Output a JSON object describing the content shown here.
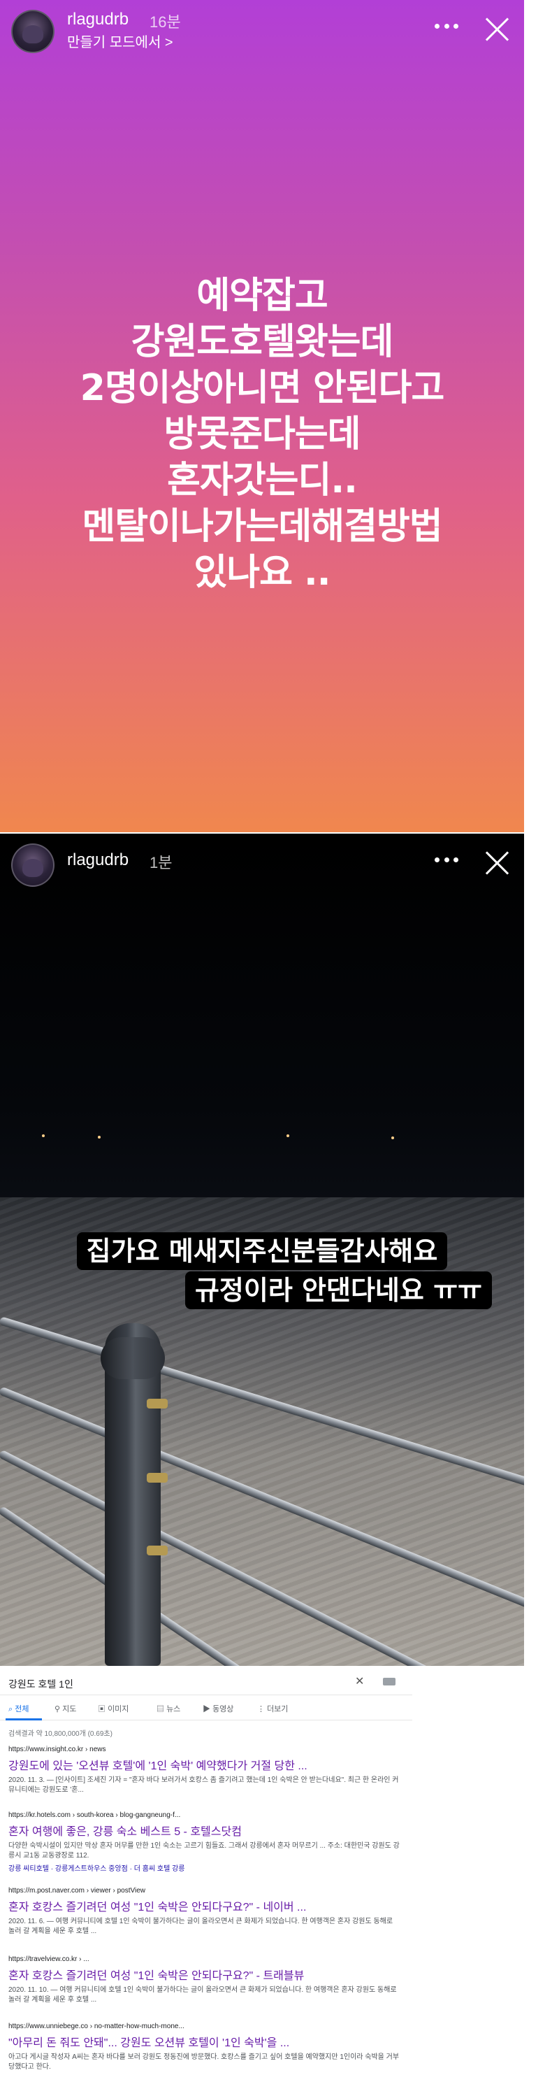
{
  "story1": {
    "username": "rlagudrb",
    "time": "16분",
    "subtitle": "만들기 모드에서 >",
    "lines": [
      "예약잡고",
      "강원도호텔왓는데",
      "2명이상아니면 안된다고",
      "방못준다는데",
      "혼자갓는디..",
      "멘탈이나가는데해결방법",
      "있나요 .."
    ]
  },
  "story2": {
    "username": "rlagudrb",
    "time": "1분",
    "caption_line1": "집가요 메새지주신분들감사해요",
    "caption_line2": "규정이라 안댄다네요 ㅠㅠ"
  },
  "search": {
    "query": "강원도 호텔 1인",
    "clear": "✕",
    "tabs": [
      "전체",
      "지도",
      "이미지",
      "뉴스",
      "동영상",
      "더보기"
    ],
    "result_count": "검색결과 약 10,800,000개 (0.69초)",
    "results": [
      {
        "url": "https://www.insight.co.kr › news",
        "title": "강원도에 있는 '오션뷰 호텔'에 '1인 숙박' 예약했다가 거절 당한 ...",
        "snippet": "2020. 11. 3. — [인사이트] 조세진 기자 = \"혼자 바다 보러가서 호캉스 좀 즐기려고 했는데 1인 숙박은 안 받는다네요\". 최근 한 온라인 커뮤니티에는 강원도로 '혼...",
        "links": ""
      },
      {
        "url": "https://kr.hotels.com › south-korea › blog-gangneung-f...",
        "title": "혼자 여행에 좋은, 강릉 숙소 베스트 5 - 호텔스닷컴",
        "snippet": "다양한 숙박시설이 있지만 막상 혼자 머무를 만한 1인 숙소는 고르기 힘들죠. 그래서 강릉에서 혼자 머무르기 ... 주소: 대한민국 강원도 강릉시 교1동 교동광장로 112.",
        "links": "강릉 씨티호텔 · 강릉게스트하우스 중앙점 · 더 홈씨 호텔 강릉"
      },
      {
        "url": "https://m.post.naver.com › viewer › postView",
        "title": "혼자 호캉스 즐기려던 여성 \"1인 숙박은 안되다구요?\" - 네이버 ...",
        "snippet": "2020. 11. 6. — 여행 커뮤니티에 호텔 1인 숙박이 불가하다는 글이 올라오면서 큰 화제가 되었습니다. 한 여행객은 혼자 강원도 동해로 놀러 갈 계획을 세운 후 호텔 ...",
        "links": ""
      },
      {
        "url": "https://travelview.co.kr › ...",
        "title": "혼자 호캉스 즐기려던 여성 \"1인 숙박은 안되다구요?\" - 트래블뷰",
        "snippet": "2020. 11. 10. — 여행 커뮤니티에 호텔 1인 숙박이 불가하다는 글이 올라오면서 큰 화제가 되었습니다. 한 여행객은 혼자 강원도 동해로 놀러 갈 계획을 세운 후 호텔 ...",
        "links": ""
      },
      {
        "url": "https://www.unniebege.co › no-matter-how-much-mone...",
        "title": "\"아무리 돈 줘도 안돼\"... 강원도 오션뷰 호텔이 '1인 숙박'을 ...",
        "snippet": "아고다 게시글 작성자 A씨는 혼자 바다를 보러 강원도 정동진에 방문했다. 호캉스를 즐기고 싶어 호텔을 예약했지만 1인이라 숙박을 거부당했다고 한다.",
        "links": ""
      }
    ]
  }
}
